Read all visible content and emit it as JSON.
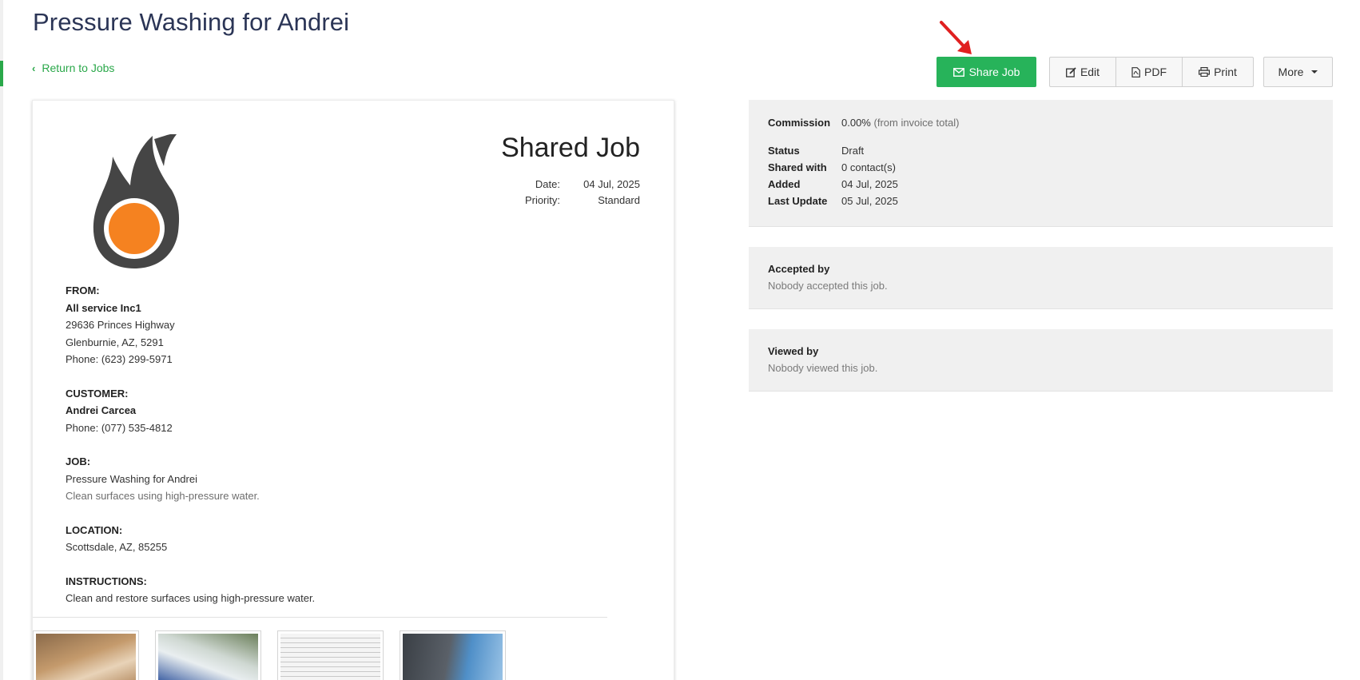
{
  "page": {
    "title": "Pressure Washing for Andrei",
    "return_label": "Return to Jobs"
  },
  "toolbar": {
    "share_label": "Share Job",
    "edit_label": "Edit",
    "pdf_label": "PDF",
    "print_label": "Print",
    "more_label": "More"
  },
  "document": {
    "title": "Shared Job",
    "date_label": "Date:",
    "date_value": "04 Jul, 2025",
    "priority_label": "Priority:",
    "priority_value": "Standard",
    "from": {
      "heading": "FROM:",
      "name": "All service Inc1",
      "address1": "29636 Princes Highway",
      "address2": "Glenburnie, AZ, 5291",
      "phone": "Phone: (623) 299-5971"
    },
    "customer": {
      "heading": "CUSTOMER:",
      "name": "Andrei Carcea",
      "phone": "Phone: (077) 535-4812"
    },
    "job": {
      "heading": "JOB:",
      "name": "Pressure Washing for Andrei",
      "description": "Clean surfaces using high-pressure water."
    },
    "location": {
      "heading": "LOCATION:",
      "address": "Scottsdale, AZ, 85255"
    },
    "instructions": {
      "heading": "INSTRUCTIONS:",
      "text": "Clean and restore surfaces using high-pressure water."
    }
  },
  "info": {
    "commission_label": "Commission",
    "commission_value": "0.00%",
    "commission_note": "(from invoice total)",
    "status_label": "Status",
    "status_value": "Draft",
    "shared_label": "Shared with",
    "shared_value": "0 contact(s)",
    "added_label": "Added",
    "added_value": "04 Jul, 2025",
    "updated_label": "Last Update",
    "updated_value": "05 Jul, 2025"
  },
  "accepted": {
    "heading": "Accepted by",
    "text": "Nobody accepted this job."
  },
  "viewed": {
    "heading": "Viewed by",
    "text": "Nobody viewed this job."
  },
  "colors": {
    "accent_green": "#27b35a",
    "title_navy": "#2b3556",
    "logo_orange": "#f58220",
    "arrow_red": "#e02020"
  }
}
